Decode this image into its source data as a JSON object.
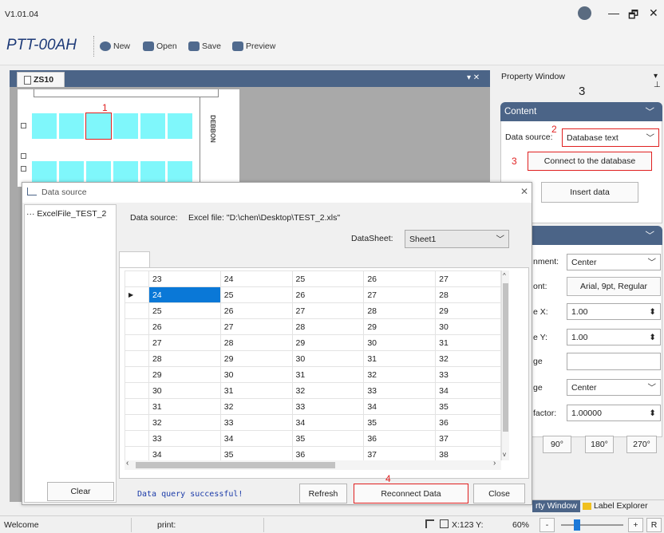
{
  "window": {
    "version": "V1.01.04",
    "minimize": "—",
    "restore": "🗗",
    "close": "✕"
  },
  "toolbar": {
    "app_title": "PTT-00AH",
    "new_label": "New",
    "open_label": "Open",
    "save_label": "Save",
    "preview_label": "Preview"
  },
  "doc": {
    "tab_label": "ZS10",
    "cell_marker": "1",
    "device_text": "DEBBON"
  },
  "property_window": {
    "title": "Property Window",
    "annotation": "3",
    "content": {
      "header": "Content",
      "data_source_label": "Data source:",
      "data_source_value": "Database text",
      "marker_2": "2",
      "marker_3": "3",
      "connect_button": "Connect to the database",
      "insert_button": "Insert data"
    },
    "format": {
      "alignment_label": "nment:",
      "alignment_value": "Center",
      "font_label": "ont:",
      "font_value": "Arial, 9pt, Regular",
      "scalex_label": "e X:",
      "scalex_value": "1.00",
      "scaley_label": "e Y:",
      "scaley_value": "1.00",
      "range_label": "ge",
      "align2_label": "ge",
      "align2_value": "Center",
      "factor_label": "factor:",
      "factor_value": "1.00000",
      "rot90": "90°",
      "rot180": "180°",
      "rot270": "270°"
    },
    "bottom_tabs": {
      "property": "rty Window",
      "label_explorer": "Label Explorer"
    }
  },
  "dialog": {
    "title": "Data source",
    "tree_item": "ExcelFile_TEST_2",
    "source_label": "Data source:",
    "source_value": "Excel file: \"D:\\chen\\Desktop\\TEST_2.xls\"",
    "datasheet_label": "DataSheet:",
    "datasheet_value": "Sheet1",
    "columns": [
      "23",
      "24",
      "25",
      "26",
      "27"
    ],
    "rows": [
      [
        "24",
        "25",
        "26",
        "27",
        "28"
      ],
      [
        "25",
        "26",
        "27",
        "28",
        "29"
      ],
      [
        "26",
        "27",
        "28",
        "29",
        "30"
      ],
      [
        "27",
        "28",
        "29",
        "30",
        "31"
      ],
      [
        "28",
        "29",
        "30",
        "31",
        "32"
      ],
      [
        "29",
        "30",
        "31",
        "32",
        "33"
      ],
      [
        "30",
        "31",
        "32",
        "33",
        "34"
      ],
      [
        "31",
        "32",
        "33",
        "34",
        "35"
      ],
      [
        "32",
        "33",
        "34",
        "35",
        "36"
      ],
      [
        "33",
        "34",
        "35",
        "36",
        "37"
      ],
      [
        "34",
        "35",
        "36",
        "37",
        "38"
      ]
    ],
    "clear_button": "Clear",
    "status_text": "Data query successful!",
    "refresh_button": "Refresh",
    "reconnect_button": "Reconnect Data",
    "marker_4": "4",
    "close_button": "Close"
  },
  "statusbar": {
    "welcome": "Welcome",
    "print": "print:",
    "coords": "X:123  Y:",
    "zoom": "60%",
    "minus": "-",
    "plus": "+",
    "reset": "R"
  }
}
